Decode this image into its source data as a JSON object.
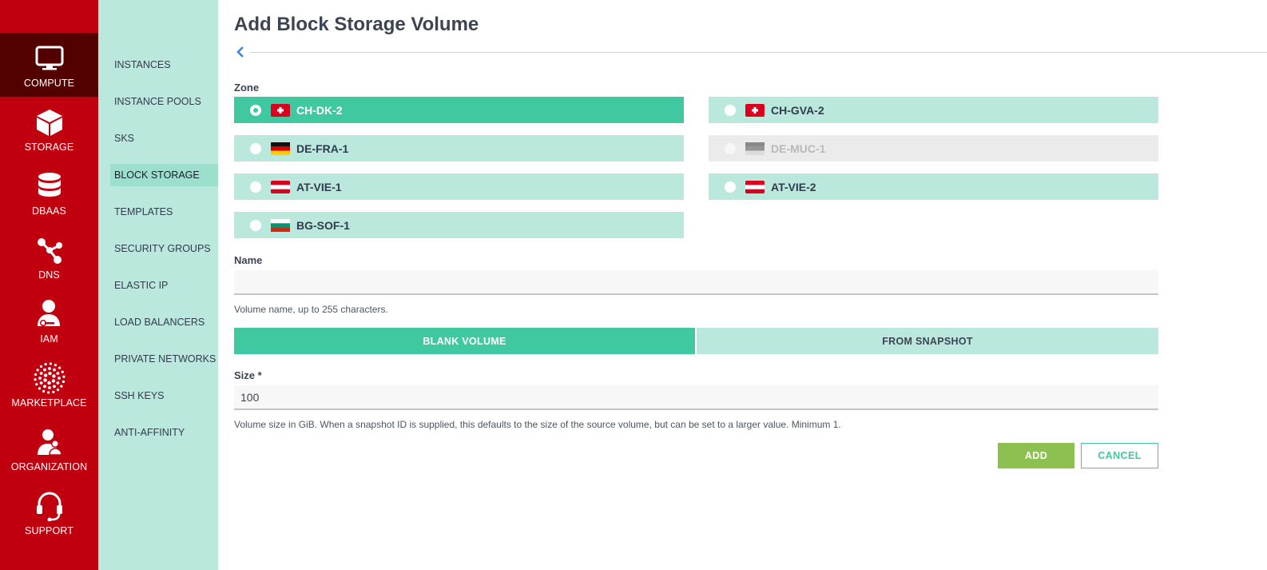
{
  "rail": {
    "items": [
      {
        "label": "COMPUTE",
        "icon": "monitor-icon"
      },
      {
        "label": "STORAGE",
        "icon": "box-icon"
      },
      {
        "label": "DBAAS",
        "icon": "database-icon"
      },
      {
        "label": "DNS",
        "icon": "network-icon"
      },
      {
        "label": "IAM",
        "icon": "user-key-icon"
      },
      {
        "label": "MARKETPLACE",
        "icon": "burst-icon"
      },
      {
        "label": "ORGANIZATION",
        "icon": "organization-icon"
      },
      {
        "label": "SUPPORT",
        "icon": "headset-icon"
      }
    ],
    "active": "COMPUTE",
    "color": "#c0000f"
  },
  "subnav": {
    "items": [
      {
        "label": "INSTANCES"
      },
      {
        "label": "INSTANCE POOLS"
      },
      {
        "label": "SKS"
      },
      {
        "label": "BLOCK STORAGE"
      },
      {
        "label": "TEMPLATES"
      },
      {
        "label": "SECURITY GROUPS"
      },
      {
        "label": "ELASTIC IP"
      },
      {
        "label": "LOAD BALANCERS"
      },
      {
        "label": "PRIVATE NETWORKS"
      },
      {
        "label": "SSH KEYS"
      },
      {
        "label": "ANTI-AFFINITY"
      }
    ],
    "active": "BLOCK STORAGE"
  },
  "page": {
    "title": "Add Block Storage Volume",
    "zone_label": "Zone",
    "zones": [
      {
        "name": "CH-DK-2",
        "flag": "switzerland",
        "state": "selected"
      },
      {
        "name": "CH-GVA-2",
        "flag": "switzerland",
        "state": "available"
      },
      {
        "name": "DE-FRA-1",
        "flag": "germany",
        "state": "available"
      },
      {
        "name": "DE-MUC-1",
        "flag": "germany",
        "state": "disabled"
      },
      {
        "name": "AT-VIE-1",
        "flag": "austria",
        "state": "available"
      },
      {
        "name": "AT-VIE-2",
        "flag": "austria",
        "state": "available"
      },
      {
        "name": "BG-SOF-1",
        "flag": "bulgaria",
        "state": "available"
      }
    ],
    "name_label": "Name",
    "name_value": "",
    "name_help": "Volume name, up to 255 characters.",
    "source_options": [
      {
        "label": "BLANK VOLUME",
        "selected": true
      },
      {
        "label": "FROM SNAPSHOT",
        "selected": false
      }
    ],
    "size_label": "Size *",
    "size_value": "100",
    "size_help": "Volume size in GiB. When a snapshot ID is supplied, this defaults to the size of the source volume, but can be set to a larger value. Minimum 1.",
    "add_label": "ADD",
    "cancel_label": "CANCEL"
  },
  "colors": {
    "accent": "#40c8a0",
    "accent_light": "#bbe8dd",
    "confirm": "#8cc152",
    "brand_red": "#c0000f",
    "rail_active": "#530000"
  }
}
